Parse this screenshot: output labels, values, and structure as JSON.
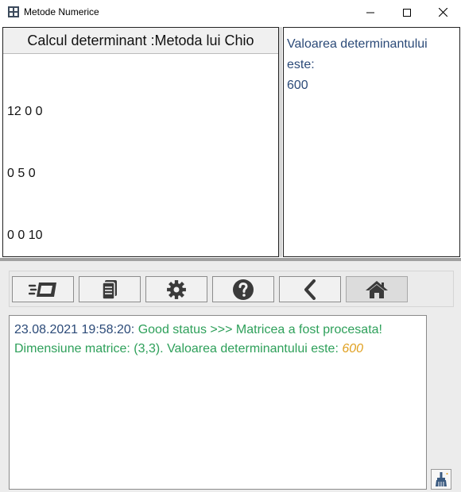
{
  "window": {
    "title": "Metode Numerice",
    "icon": "calculator-app-icon",
    "controls": [
      "minimize-icon",
      "maximize-icon",
      "close-icon"
    ]
  },
  "left_panel": {
    "header": "Calcul determinant :Metoda lui Chio",
    "matrix_rows": [
      "12 0 0",
      "0 5 0",
      "0 0 10"
    ]
  },
  "right_panel": {
    "label": "Valoarea determinantului este:",
    "value": "600"
  },
  "toolbar": {
    "buttons": [
      {
        "name": "process-button",
        "icon": "card-speed-icon"
      },
      {
        "name": "document-button",
        "icon": "document-icon"
      },
      {
        "name": "settings-button",
        "icon": "gear-icon"
      },
      {
        "name": "help-button",
        "icon": "question-icon"
      },
      {
        "name": "back-button",
        "icon": "chevron-left-icon"
      },
      {
        "name": "home-button",
        "icon": "home-icon",
        "selected": true
      }
    ]
  },
  "log": {
    "timestamp": "23.08.2021 19:58:20:",
    "status": " Good status >>> Matricea a fost procesata!",
    "detail": "Dimensiune matrice: (3,3). Valoarea determinantului este:",
    "value": "600"
  },
  "clear_button_icon": "broom-icon",
  "colors": {
    "timestamp": "#2b4a78",
    "good": "#2ea05a",
    "value_highlight": "#e0a020",
    "result_text": "#2b4a78"
  }
}
